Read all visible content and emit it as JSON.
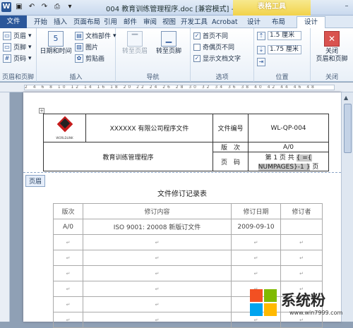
{
  "titlebar": {
    "app_icon": "W",
    "title": "004 教育训练管理程序.doc [兼容模式] - M...",
    "context_tab": "表格工具",
    "qat_icons": [
      "save-icon",
      "undo-icon",
      "redo-icon",
      "print-icon"
    ]
  },
  "tabs": [
    "文件",
    "开始",
    "插入",
    "页面布局",
    "引用",
    "邮件",
    "审阅",
    "视图",
    "开发工具",
    "Acrobat",
    "设计",
    "布局",
    "设计"
  ],
  "ribbon": {
    "header_footer": {
      "header": "页眉",
      "footer": "页脚",
      "page_number": "页码",
      "label": "页眉和页脚"
    },
    "insert": {
      "datetime": "日期和时间",
      "doc_parts": "文档部件",
      "picture": "图片",
      "clipart": "剪贴画",
      "label": "插入"
    },
    "navigation": {
      "goto_header": "转至页眉",
      "goto_footer": "转至页脚",
      "label": "导航"
    },
    "options": {
      "first_page": "首页不同",
      "odd_even": "奇偶页不同",
      "show_text": "显示文档文字",
      "label": "选项"
    },
    "position": {
      "header_top": "1.5 厘米",
      "footer_bottom": "1.75 厘米",
      "label": "位置"
    },
    "close": {
      "line1": "关闭",
      "line2": "页眉和页脚",
      "label": "关闭"
    }
  },
  "ruler_marks": "2 4 6 8 10 12 14 16 18 20 22 24 26 28 30 32 34 36 38 40 42 44 46 48",
  "header_table": {
    "company": "XXXXXX 有限公司程序文件",
    "doc_no_label": "文件编号",
    "doc_no": "WL-QP-004",
    "doc_name": "教育训练管理程序",
    "version_label": "版　次",
    "version": "A/0",
    "page_label": "页　码",
    "page_text": "第 1 页 共",
    "page_field": "{ ={ NUMPAGES}-1 }",
    "page_suffix": "页",
    "brand_text": "WORLDLINK"
  },
  "header_tag": "页眉",
  "doc_title": "文件修订记录表",
  "revision_table": {
    "headers": [
      "版次",
      "修订内容",
      "修订日期",
      "修订者"
    ],
    "rows": [
      [
        "A/0",
        "ISO 9001: 20008 新版订文件",
        "2009-09-10",
        ""
      ]
    ]
  },
  "watermark": {
    "main": "系统粉",
    "sub": "www.win7999.com"
  },
  "colors": {
    "word_blue": "#2b579a",
    "context_yellow": "#f2d24a",
    "logo_red": "#c51b1b"
  }
}
